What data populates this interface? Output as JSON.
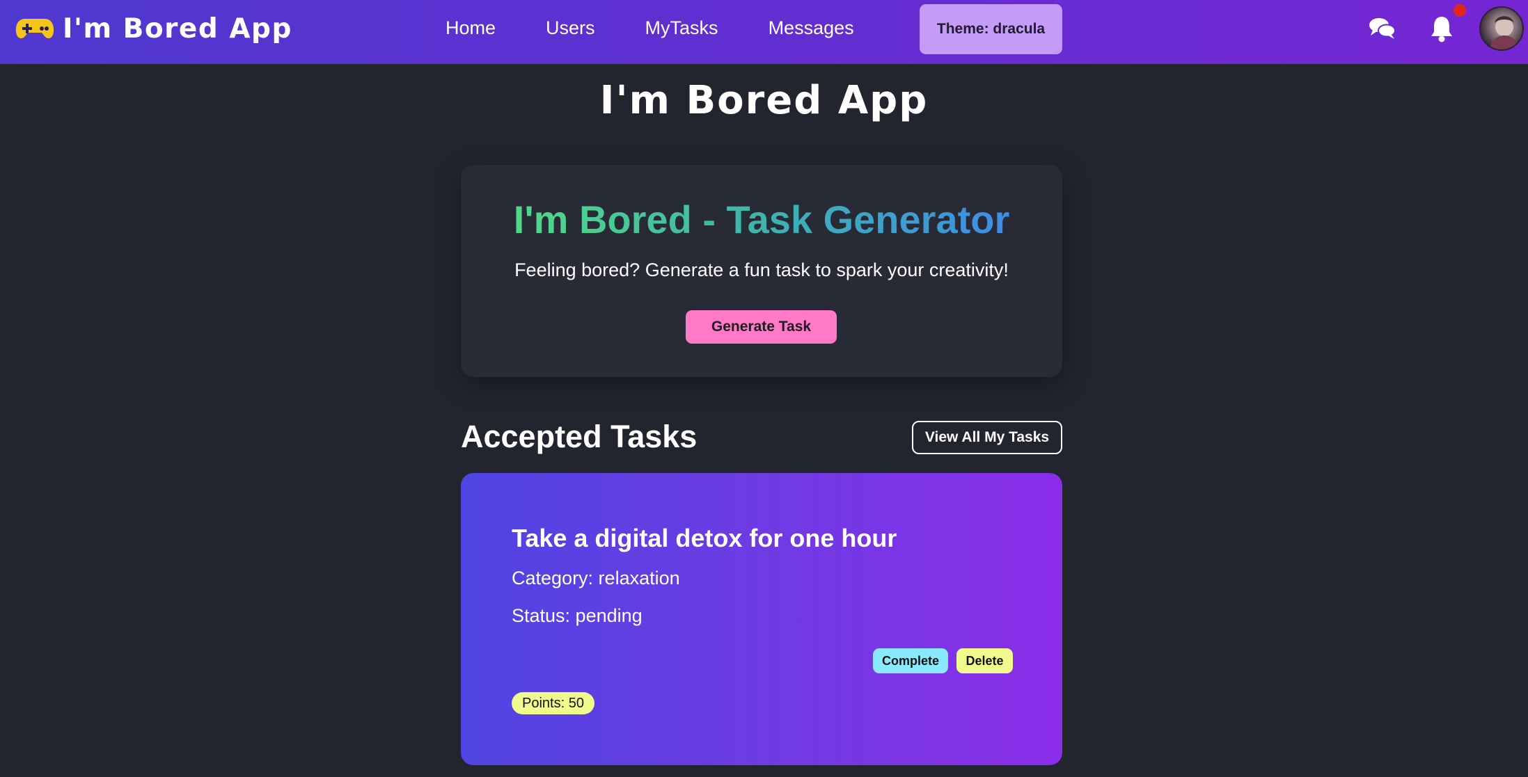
{
  "navbar": {
    "brand": "I'm Bored App",
    "brand_icon": "gamepad-icon",
    "links": [
      "Home",
      "Users",
      "MyTasks",
      "Messages"
    ],
    "theme_button": "Theme: dracula",
    "icons": [
      "chat-icon",
      "bell-icon"
    ],
    "has_notification": true
  },
  "page": {
    "title": "I'm Bored App"
  },
  "generator": {
    "title": "I'm Bored - Task Generator",
    "subtitle": "Feeling bored? Generate a fun task to spark your creativity!",
    "button": "Generate Task"
  },
  "accepted": {
    "heading": "Accepted Tasks",
    "view_all": "View All My Tasks",
    "tasks": [
      {
        "title": "Take a digital detox for one hour",
        "category": "Category: relaxation",
        "status": "Status: pending",
        "complete_label": "Complete",
        "delete_label": "Delete",
        "points": "Points: 50"
      }
    ]
  },
  "colors": {
    "background": "#22252e",
    "card": "#282a36",
    "pink": "#ff79c6",
    "cyan": "#8be9fd",
    "yellow": "#f1fa8c",
    "purple_light": "#c49cf7",
    "notification": "#e2261c"
  }
}
